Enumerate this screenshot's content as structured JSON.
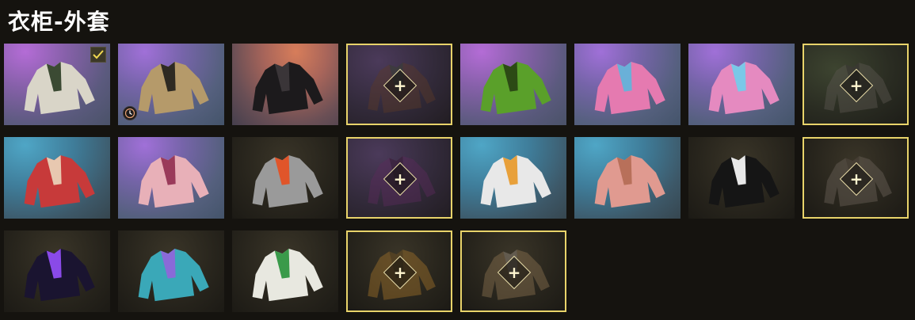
{
  "header": {
    "title": "衣柜-外套"
  },
  "colors": {
    "locked_border": "#e8d36a",
    "background": "#15130f"
  },
  "grid": {
    "rows": [
      [
        {
          "item": "mech-jacket",
          "bg": "purple",
          "equipped": true
        },
        {
          "item": "plaid-coat",
          "bg": "violet",
          "timed": true
        },
        {
          "item": "black-bodysuit",
          "bg": "orange"
        },
        {
          "item": "brown-jacket",
          "bg": "darkpurple",
          "locked": true
        },
        {
          "item": "green-camo-jacket",
          "bg": "purple"
        },
        {
          "item": "pink-crop-sweater",
          "bg": "violet"
        },
        {
          "item": "puffer-vest",
          "bg": "violet"
        },
        {
          "item": "grey-bomber",
          "bg": "darkgreen",
          "locked": true
        }
      ],
      [
        {
          "item": "red-floral-shirt",
          "bg": "blue"
        },
        {
          "item": "pink-jacket",
          "bg": "violet"
        },
        {
          "item": "grey-orange-jacket",
          "bg": "dark"
        },
        {
          "item": "purple-jacket",
          "bg": "darkpurple",
          "locked": true
        },
        {
          "item": "white-tank-top",
          "bg": "blue"
        },
        {
          "item": "pink-ruffle-dress",
          "bg": "blue"
        },
        {
          "item": "black-hoodie",
          "bg": "dark"
        },
        {
          "item": "camo-jacket",
          "bg": "dark",
          "locked": true
        }
      ],
      [
        {
          "item": "purple-glow-jacket",
          "bg": "dark"
        },
        {
          "item": "bunny-ear-hoodie",
          "bg": "dark"
        },
        {
          "item": "white-green-hoodie",
          "bg": "dark"
        },
        {
          "item": "tan-vest",
          "bg": "dark",
          "locked": true
        },
        {
          "item": "tan-grey-jacket",
          "bg": "dark",
          "locked": true
        }
      ]
    ],
    "locked_symbol": "+"
  }
}
